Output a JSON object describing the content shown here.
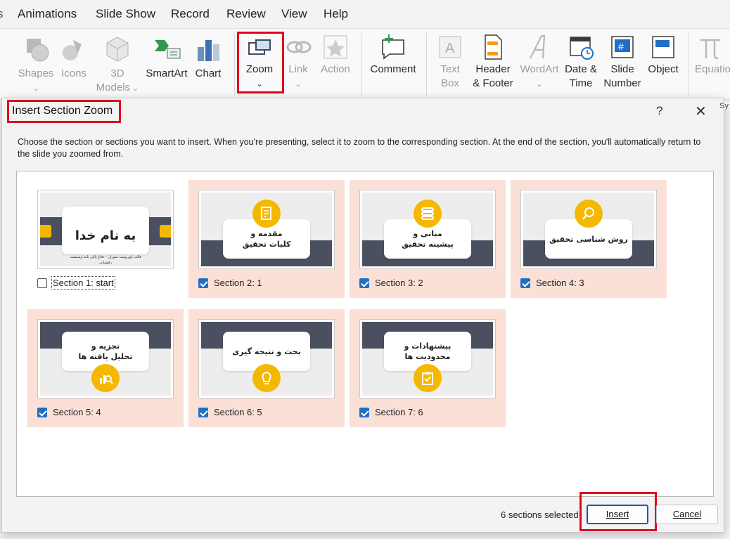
{
  "menu": [
    "Animations",
    "Slide Show",
    "Record",
    "Review",
    "View",
    "Help"
  ],
  "ribbon": {
    "shapes": "Shapes",
    "icons": "Icons",
    "models_line1": "3D",
    "models_line2": "Models",
    "smartart": "SmartArt",
    "chart": "Chart",
    "zoom": "Zoom",
    "link": "Link",
    "action": "Action",
    "comment": "Comment",
    "textbox_line1": "Text",
    "textbox_line2": "Box",
    "header_line1": "Header",
    "header_line2": "& Footer",
    "wordart": "WordArt",
    "datetime_line1": "Date &",
    "datetime_line2": "Time",
    "slidenum_line1": "Slide",
    "slidenum_line2": "Number",
    "object": "Object",
    "equation": "Equatio",
    "symbol_fragment": "Sy"
  },
  "dialog": {
    "title": "Insert Section Zoom",
    "help": "?",
    "close": "✕",
    "description": "Choose the section or sections you want to insert. When you're presenting, select it to zoom to the corresponding section. At the end of the section, you'll automatically return to the slide you zoomed from.",
    "sections": [
      {
        "label": "Section 1: start",
        "checked": false,
        "slide_title": "به نام خدا",
        "slide_sub": "قالب پاورپوینت سوزان - دفاع پایان نامه وسیست راهنمایی"
      },
      {
        "label": "Section 2: 1",
        "checked": true,
        "slide_text": "مقدمه و\nکلیات تحقیق",
        "icon": "document-pen-icon"
      },
      {
        "label": "Section 3: 2",
        "checked": true,
        "slide_text": "مبانی و\nپیشینه تحقیق",
        "icon": "books-icon"
      },
      {
        "label": "Section 4: 3",
        "checked": true,
        "slide_text": "روش شناسی تحقیق",
        "icon": "magnifier-icon"
      },
      {
        "label": "Section 5: 4",
        "checked": true,
        "slide_text": "تجزیه و\nتحلیل یافته ها",
        "icon": "chart-search-icon"
      },
      {
        "label": "Section 6: 5",
        "checked": true,
        "slide_text": "بحث و نتیجه گیری",
        "icon": "lightbulb-icon"
      },
      {
        "label": "Section 7: 6",
        "checked": true,
        "slide_text": "پیشنهادات و\nمحدودیت ها",
        "icon": "clipboard-check-icon"
      }
    ],
    "status": "6 sections selected",
    "insert": "Insert",
    "cancel": "Cancel"
  },
  "colors": {
    "selected_tile": "#fbe0d8",
    "highlight": "#e0061d",
    "accent_yellow": "#f5b800",
    "slide_band": "#4a5060",
    "checkbox": "#1f6fc5"
  }
}
